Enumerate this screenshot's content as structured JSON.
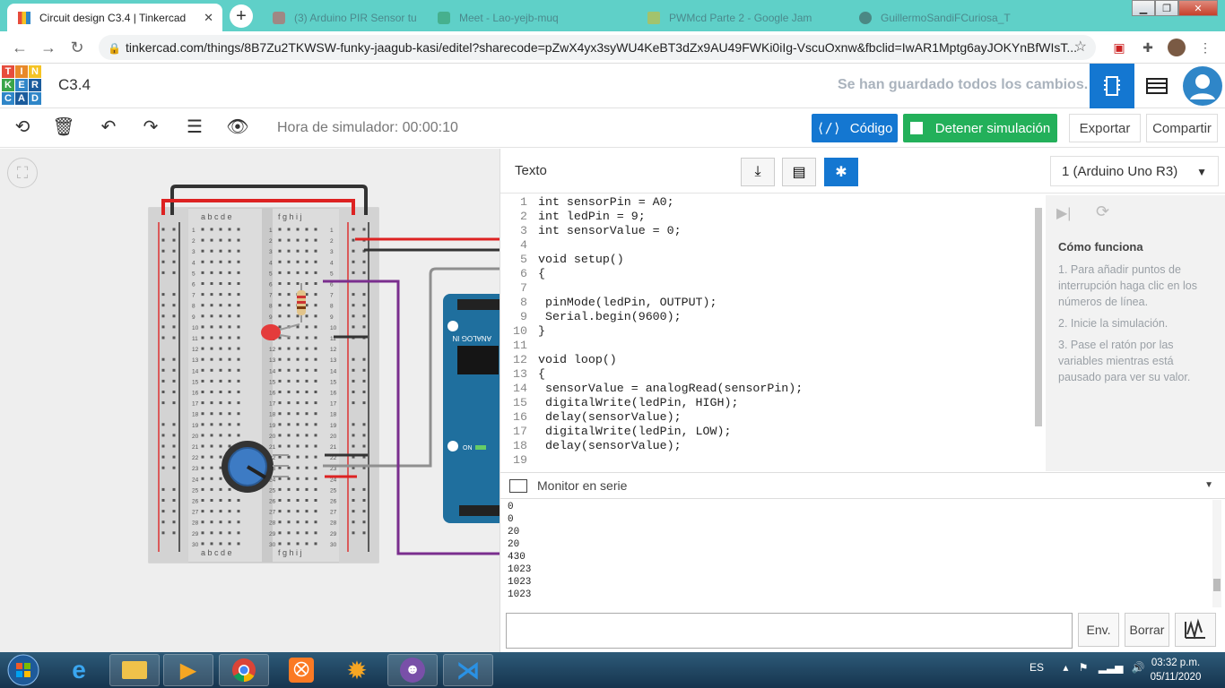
{
  "browser": {
    "tabs": [
      {
        "title": "Circuit design C3.4 | Tinkercad",
        "active": true
      },
      {
        "title": "(3) Arduino PIR Sensor tu",
        "active": false
      },
      {
        "title": "Meet - Lao-yejb-muq",
        "active": false
      },
      {
        "title": "PWMcd Parte 2 - Google Jam",
        "active": false
      },
      {
        "title": "GuillermoSandiFCuriosa_T",
        "active": false
      }
    ],
    "url": "tinkercad.com/things/8B7Zu2TKWSW-funky-jaagub-kasi/editel?sharecode=pZwX4yx3syWU4KeBT3dZx9AU49FWKi0iIg-VscuOxnw&fbclid=IwAR1Mptg6ayJOKYnBfWIsT..."
  },
  "app": {
    "logo_letters": [
      "T",
      "I",
      "N",
      "K",
      "E",
      "R",
      "C",
      "A",
      "D"
    ],
    "logo_colors": [
      "#e64c3c",
      "#e8892a",
      "#f5c324",
      "#3aa54a",
      "#2f86c8",
      "#1a5b9c",
      "#2f86c8",
      "#1a5b9c",
      "#2f86c8"
    ],
    "project_name": "C3.4",
    "save_status": "Se han guardado todos los cambios."
  },
  "toolbar": {
    "sim_time": "Hora de simulador: 00:00:10",
    "code_label": "Código",
    "stop_label": "Detener simulación",
    "export_label": "Exportar",
    "share_label": "Compartir"
  },
  "code_panel": {
    "mode": "Texto",
    "device": "1 (Arduino Uno R3)",
    "lines": [
      "int sensorPin = A0;",
      "int ledPin = 9;",
      "int sensorValue = 0;",
      "",
      "void setup()",
      "{",
      "",
      " pinMode(ledPin, OUTPUT);",
      " Serial.begin(9600);",
      "}",
      "",
      "void loop()",
      "{",
      " sensorValue = analogRead(sensorPin);",
      " digitalWrite(ledPin, HIGH);",
      " delay(sensorValue);",
      " digitalWrite(ledPin, LOW);",
      " delay(sensorValue);",
      ""
    ],
    "debug": {
      "title": "Cómo funciona",
      "steps": [
        "1. Para añadir puntos de interrupción haga clic en los números de línea.",
        "2. Inicie la simulación.",
        "3. Pase el ratón por las variables mientras está pausado para ver su valor."
      ]
    },
    "monitor": {
      "title": "Monitor en serie",
      "output": [
        "0",
        "0",
        "20",
        "20",
        "430",
        "1023",
        "1023",
        "1023"
      ],
      "send_label": "Env.",
      "clear_label": "Borrar"
    }
  },
  "breadboard": {
    "columns_left": "a b c d e",
    "columns_right": "f g h i j",
    "rows": [
      "1",
      "2",
      "3",
      "4",
      "5",
      "6",
      "7",
      "8",
      "9",
      "10",
      "11",
      "12",
      "13",
      "14",
      "15",
      "16",
      "17",
      "18",
      "19",
      "20",
      "21",
      "22",
      "23",
      "24",
      "25",
      "26",
      "27",
      "28",
      "29",
      "30"
    ]
  },
  "arduino": {
    "analog_label": "ANALOG IN",
    "on_label": "ON",
    "pins": [
      "A5",
      "A4",
      "A3",
      "A2"
    ]
  },
  "taskbar": {
    "lang": "ES",
    "time": "03:32 p.m.",
    "date": "05/11/2020"
  }
}
